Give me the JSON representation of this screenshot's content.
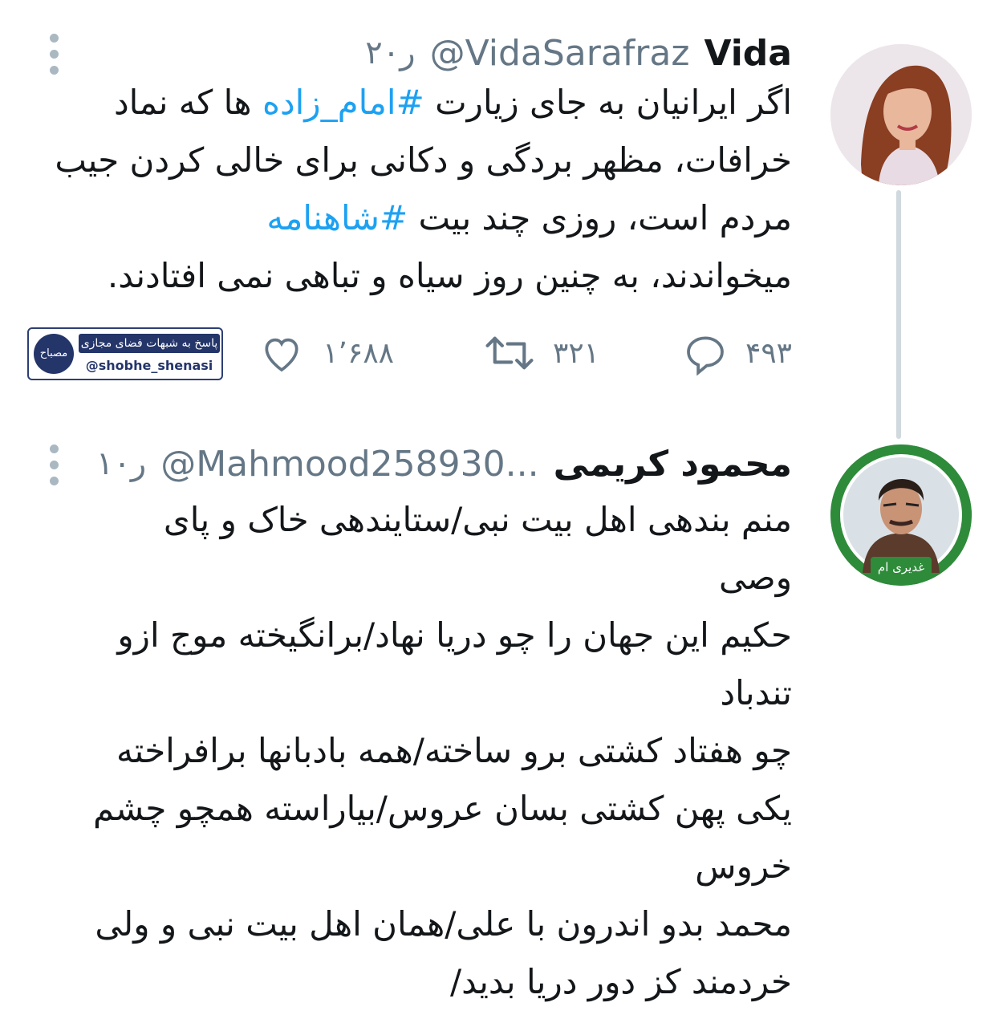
{
  "tweet1": {
    "name": "Vida",
    "handle": "@VidaSarafraz",
    "time": "۲۰ر",
    "text_before": "اگر ایرانیان به جای زیارت ",
    "hashtag1": "#امام_زاده",
    "text_middle": " ها که نماد خرافات، مظهر بردگی و دکانی برای خالی کردن جیب مردم است، روزی چند بیت ",
    "hashtag2": "#شاهنامه",
    "text_after": "\nمیخواندند، به چنین روز سیاه و تباهی نمی افتادند.",
    "replies": "۴۹۳",
    "retweets": "۳۲۱",
    "likes": "۱٬۶۸۸"
  },
  "watermark": {
    "top_text": "پاسخ به شبهات فضای مجازی",
    "handle": "@shobhe_shenasi",
    "logo_text": "مصباح"
  },
  "tweet2": {
    "name": "محمود کریمی",
    "handle": "@Mahmood258930...",
    "time": "۱۰ر",
    "text": "منم بندهی اهل بیت نبی/ستایندهی خاک و پای\nوصی\nحکیم این جهان را چو دریا نهاد/برانگیخته موج ازو\nتندباد\nچو هفتاد کشتی برو ساخته/همه بادبانها برافراخته\nیکی پهن کشتی بسان عروس/بیاراسته همچو چشم\nخروس\nمحمد بدو اندرون با علی/همان اهل بیت نبی و ولی\nخردمند کز دور دریا بدید/",
    "avatar_badge": "غدیری ام"
  },
  "colors": {
    "hashtag": "#1da1f2",
    "secondary_text": "#657786",
    "thread_line": "#cfd9de",
    "avatar2_border": "#2e8b3a"
  }
}
